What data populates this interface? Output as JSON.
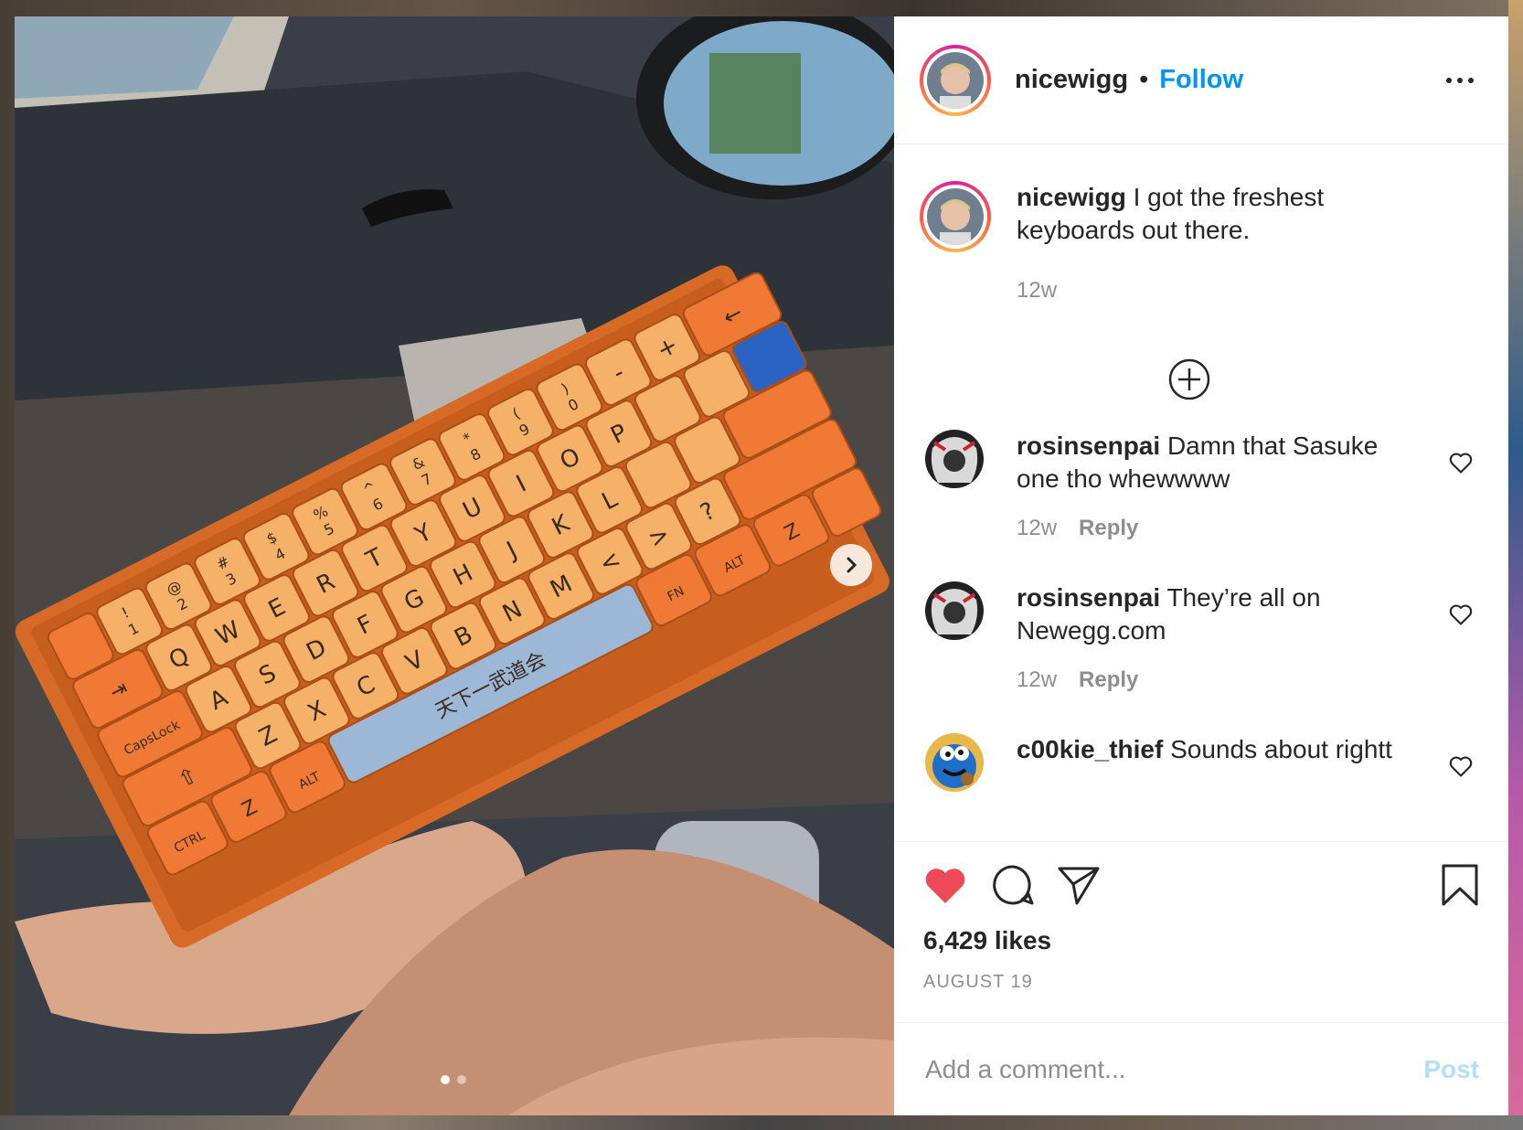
{
  "post": {
    "username": "nicewigg",
    "follow_label": "Follow",
    "caption_username": "nicewigg",
    "caption_text": " I got the freshest keyboards out there.",
    "caption_time": "12w",
    "likes": "6,429 likes",
    "date": "AUGUST 19",
    "liked": true,
    "carousel_index": 1,
    "carousel_total": 2
  },
  "comments": [
    {
      "username": "rosinsenpai",
      "text": " Damn that Sasuke one tho whewwww",
      "time": "12w",
      "reply_label": "Reply"
    },
    {
      "username": "rosinsenpai",
      "text": " They’re all on Newegg.com",
      "time": "12w",
      "reply_label": "Reply"
    },
    {
      "username": "c00kie_thief",
      "text": " Sounds about rightt",
      "time": "",
      "reply_label": ""
    }
  ],
  "add_comment": {
    "placeholder": "Add a comment...",
    "post_label": "Post"
  },
  "photo": {
    "keycaps_row1": [
      "!\n1",
      "@\n2",
      "#\n3",
      "$\n4",
      "%\n5",
      "^\n6",
      "&\n7",
      "*\n8",
      "(\n9",
      ")\n0",
      "-",
      "+"
    ],
    "keycaps_row2": [
      "Q",
      "W",
      "E",
      "R",
      "T",
      "Y",
      "U",
      "I",
      "O",
      "P"
    ],
    "keycaps_row3": [
      "A",
      "S",
      "D",
      "F",
      "G",
      "H",
      "J",
      "K",
      "L"
    ],
    "keycaps_row4": [
      "Z",
      "X",
      "C",
      "V",
      "B",
      "N",
      "M"
    ],
    "mod_capslock": "CapsLock",
    "mod_ctrl": "CTRL",
    "mod_alt": "ALT",
    "mod_fn": "FN",
    "spacebar_text": "天下一武道会"
  },
  "colors": {
    "accent": "#0095f6",
    "like_red": "#ed4956",
    "keycap_orange": "#f07a35",
    "keycap_cream": "#f5b168"
  }
}
